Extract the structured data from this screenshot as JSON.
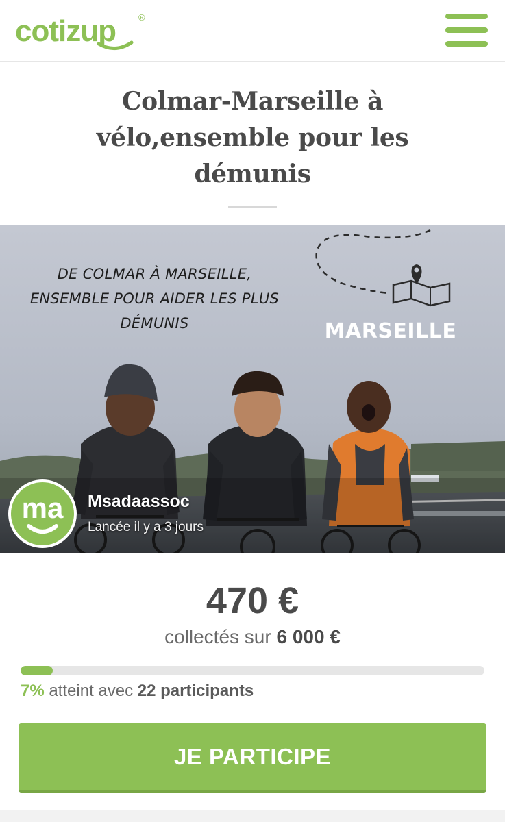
{
  "header": {
    "logo_text": "cotizup",
    "logo_mark": "®",
    "menu_icon": "hamburger-menu-icon"
  },
  "campaign": {
    "title": "Colmar-Marseille à vélo,ensemble pour les démunis",
    "banner_text": "DE COLMAR À MARSEILLE, ENSEMBLE POUR AIDER LES PLUS DÉMUNIS",
    "city_label": "MARSEILLE",
    "map_pin_icon": "map-pin-icon",
    "organizer": {
      "name": "Msadaassoc",
      "launched": "Lancée il y a 3 jours",
      "avatar_text": "ma"
    }
  },
  "funding": {
    "amount": "470 €",
    "goal_prefix": "collectés sur",
    "goal_amount": "6 000 €",
    "progress_fraction": 0.07,
    "percent": "7%",
    "stats_middle": "atteint avec",
    "participants": "22 participants"
  },
  "cta": {
    "label": "JE PARTICIPE"
  },
  "colors": {
    "brand_green": "#8dc055",
    "text_dark": "#4a4a4a",
    "vest_orange": "#e07b2e"
  }
}
